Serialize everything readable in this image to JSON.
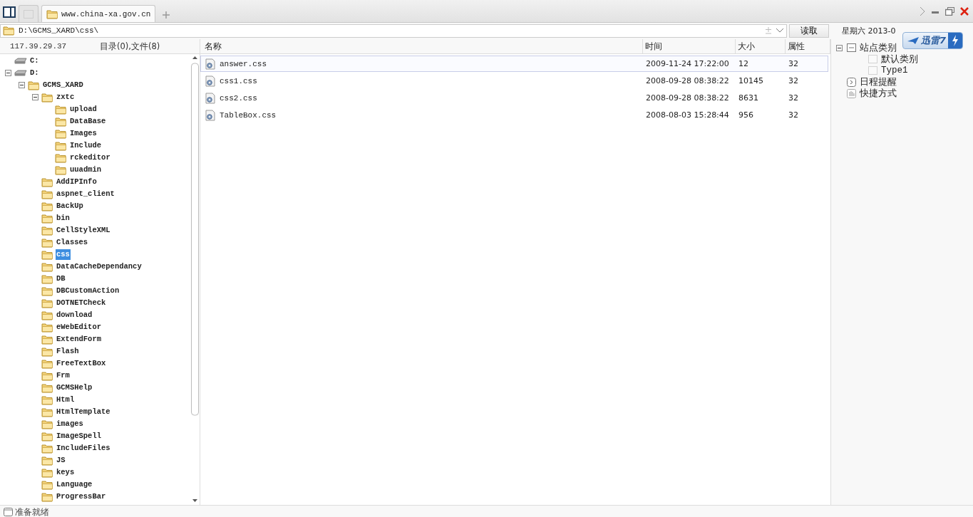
{
  "tabs": [
    {
      "kind": "blank",
      "selected": false
    },
    {
      "kind": "site",
      "label": "www.china-xa.gov.cn",
      "selected": true
    }
  ],
  "address": {
    "value": "D:\\GCMS_XARD\\css\\"
  },
  "read_button": "读取",
  "date_text": "星期六 2013-0",
  "badge": {
    "label": "迅雷7"
  },
  "server": "117.39.29.37",
  "summary": "目录(0),文件(8)",
  "tree": [
    {
      "label": "C:",
      "kind": "drive",
      "selected": false
    },
    {
      "label": "D:",
      "kind": "drive",
      "selected": false,
      "expanded": true,
      "children": [
        {
          "label": "GCMS_XARD",
          "kind": "folder",
          "selected": false,
          "expanded": true,
          "children": [
            {
              "label": "zxtc",
              "kind": "folder",
              "selected": false,
              "expanded": true,
              "children": [
                {
                  "label": "upload",
                  "kind": "folder",
                  "selected": false
                },
                {
                  "label": "DataBase",
                  "kind": "folder",
                  "selected": false
                },
                {
                  "label": "Images",
                  "kind": "folder",
                  "selected": false
                },
                {
                  "label": "Include",
                  "kind": "folder",
                  "selected": false
                },
                {
                  "label": "rckeditor",
                  "kind": "folder",
                  "selected": false
                },
                {
                  "label": "uuadmin",
                  "kind": "folder",
                  "selected": false
                }
              ]
            },
            {
              "label": "AddIPInfo",
              "kind": "folder",
              "selected": false
            },
            {
              "label": "aspnet_client",
              "kind": "folder",
              "selected": false
            },
            {
              "label": "BackUp",
              "kind": "folder",
              "selected": false
            },
            {
              "label": "bin",
              "kind": "folder",
              "selected": false
            },
            {
              "label": "CellStyleXML",
              "kind": "folder",
              "selected": false
            },
            {
              "label": "Classes",
              "kind": "folder",
              "selected": false
            },
            {
              "label": "css",
              "kind": "folder",
              "selected": true
            },
            {
              "label": "DataCacheDependancy",
              "kind": "folder",
              "selected": false
            },
            {
              "label": "DB",
              "kind": "folder",
              "selected": false
            },
            {
              "label": "DBCustomAction",
              "kind": "folder",
              "selected": false
            },
            {
              "label": "DOTNETCheck",
              "kind": "folder",
              "selected": false
            },
            {
              "label": "download",
              "kind": "folder",
              "selected": false
            },
            {
              "label": "eWebEditor",
              "kind": "folder",
              "selected": false
            },
            {
              "label": "ExtendForm",
              "kind": "folder",
              "selected": false
            },
            {
              "label": "Flash",
              "kind": "folder",
              "selected": false
            },
            {
              "label": "FreeTextBox",
              "kind": "folder",
              "selected": false
            },
            {
              "label": "Frm",
              "kind": "folder",
              "selected": false
            },
            {
              "label": "GCMSHelp",
              "kind": "folder",
              "selected": false
            },
            {
              "label": "Html",
              "kind": "folder",
              "selected": false
            },
            {
              "label": "HtmlTemplate",
              "kind": "folder",
              "selected": false
            },
            {
              "label": "images",
              "kind": "folder",
              "selected": false
            },
            {
              "label": "ImageSpell",
              "kind": "folder",
              "selected": false
            },
            {
              "label": "IncludeFiles",
              "kind": "folder",
              "selected": false
            },
            {
              "label": "JS",
              "kind": "folder",
              "selected": false
            },
            {
              "label": "keys",
              "kind": "folder",
              "selected": false
            },
            {
              "label": "Language",
              "kind": "folder",
              "selected": false
            },
            {
              "label": "ProgressBar",
              "kind": "folder",
              "selected": false
            }
          ]
        }
      ]
    }
  ],
  "files": {
    "columns": [
      "名称",
      "时间",
      "大小",
      "属性"
    ],
    "rows": [
      {
        "name": "answer.css",
        "time": "2009-11-24 17:22:00",
        "size": "12",
        "attr": "32",
        "selected": true
      },
      {
        "name": "css1.css",
        "time": "2008-09-28 08:38:22",
        "size": "10145",
        "attr": "32",
        "selected": false
      },
      {
        "name": "css2.css",
        "time": "2008-09-28 08:38:22",
        "size": "8631",
        "attr": "32",
        "selected": false
      },
      {
        "name": "TableBox.css",
        "time": "2008-08-03 15:28:44",
        "size": "956",
        "attr": "32",
        "selected": false
      }
    ]
  },
  "side_tree": [
    {
      "label": "站点类别",
      "kind": "category",
      "expanded": true,
      "children": [
        {
          "label": "默认类别",
          "kind": "item"
        },
        {
          "label": "Type1",
          "kind": "item"
        }
      ]
    },
    {
      "label": "日程提醒",
      "kind": "schedule"
    },
    {
      "label": "快捷方式",
      "kind": "shortcut"
    }
  ],
  "status": "准备就绪"
}
